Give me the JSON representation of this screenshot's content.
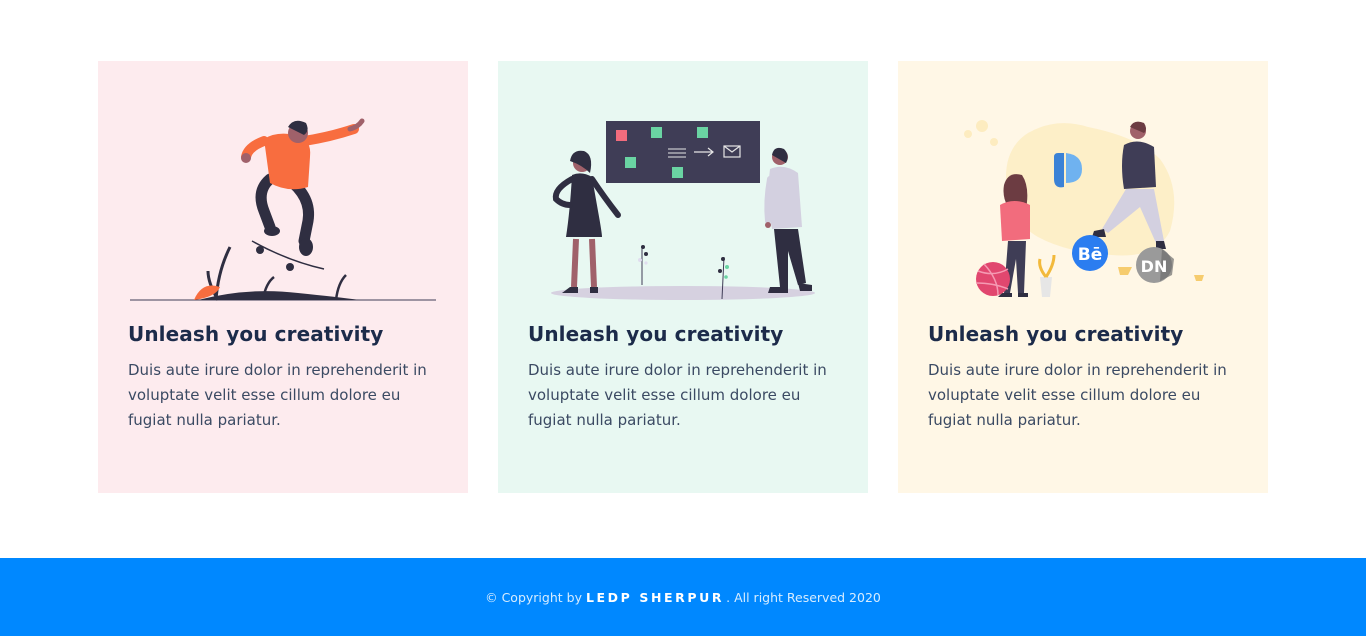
{
  "colors": {
    "card_1_bg": "#fdebee",
    "card_2_bg": "#e8f8f2",
    "card_3_bg": "#fff7e6",
    "footer_bg": "#0088ff"
  },
  "cards": [
    {
      "illustration": "skateboarder-illustration",
      "title": "Unleash you creativity",
      "text": "Duis aute irure dolor in reprehenderit in voluptate velit esse cillum dolore eu fugiat nulla pariatur."
    },
    {
      "illustration": "team-board-illustration",
      "title": "Unleash you creativity",
      "text": "Duis aute irure dolor in reprehenderit in voluptate velit esse cillum dolore eu fugiat nulla pariatur."
    },
    {
      "illustration": "social-people-illustration",
      "title": "Unleash you creativity",
      "text": "Duis aute irure dolor in reprehenderit in voluptate velit esse cillum dolore eu fugiat nulla pariatur.",
      "badges": [
        "Bē",
        "DN"
      ]
    }
  ],
  "footer": {
    "prefix": "© Copyright by",
    "brand": "LEDP SHERPUR",
    "suffix": ". All right Reserved 2020"
  }
}
